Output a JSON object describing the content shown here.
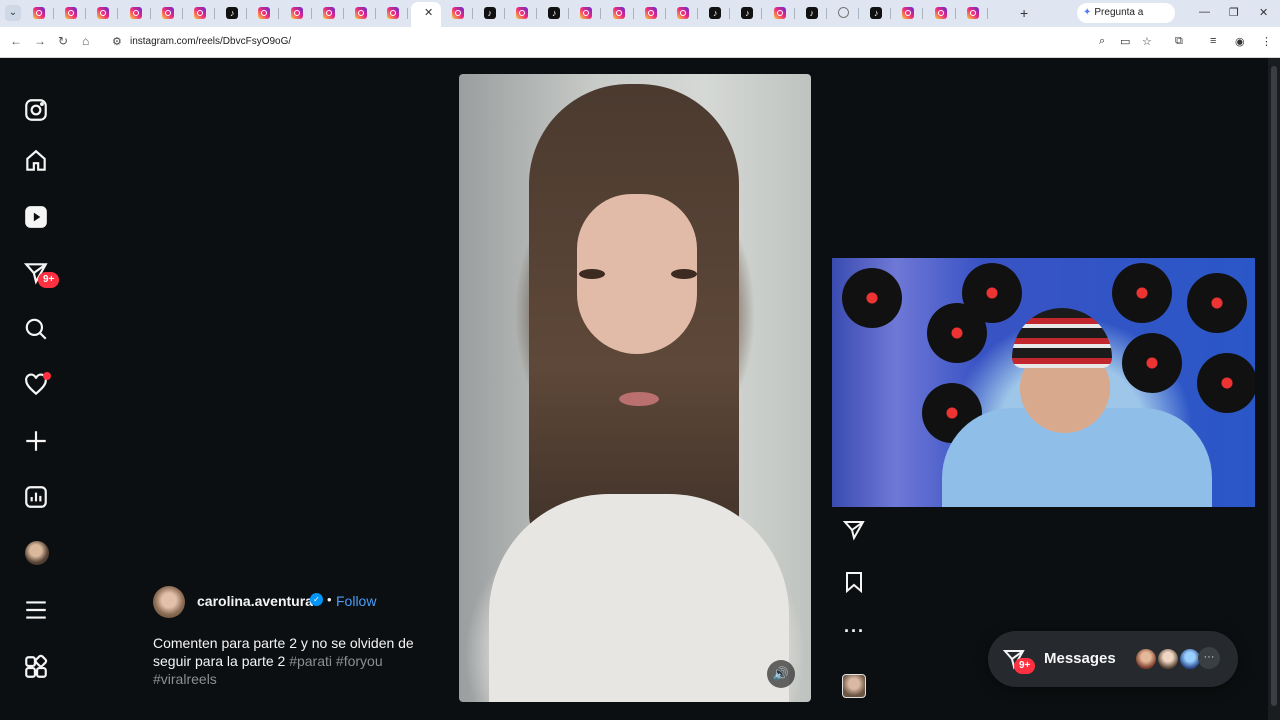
{
  "browser": {
    "url": "instagram.com/reels/DbvcFsyO9oG/",
    "gemini_label": "Pregunta a Gemini",
    "tabs": [
      "ig",
      "ig",
      "ig",
      "ig",
      "ig",
      "ig",
      "tt",
      "ig",
      "ig",
      "ig",
      "ig",
      "ig",
      "active",
      "ig",
      "tt",
      "ig",
      "tt",
      "ig",
      "ig",
      "ig",
      "ig",
      "tt",
      "tt",
      "ig",
      "tt",
      "globe",
      "tt",
      "ig",
      "ig",
      "ig"
    ]
  },
  "sidebar": {
    "items": [
      {
        "name": "instagram-logo-icon"
      },
      {
        "name": "home-icon"
      },
      {
        "name": "reels-icon"
      },
      {
        "name": "messages-icon",
        "badge": "9+"
      },
      {
        "name": "search-icon"
      },
      {
        "name": "notifications-icon"
      },
      {
        "name": "create-icon"
      },
      {
        "name": "dashboard-icon"
      },
      {
        "name": "profile-avatar"
      },
      {
        "name": "menu-icon"
      },
      {
        "name": "more-apps-icon"
      }
    ]
  },
  "reel": {
    "author": "carolina.aventura",
    "follow_label": "Follow",
    "separator": "•",
    "caption_text": "Comenten para parte 2 y no se olviden de seguir para la parte 2 ",
    "hashtags": [
      "#parati",
      "#foryou",
      "#viralreels"
    ]
  },
  "messages": {
    "label": "Messages",
    "badge": "9+",
    "more": "···"
  },
  "colors": {
    "background": "#0c0f11",
    "accent_blue": "#4a9df8",
    "badge_red": "#ff3040"
  }
}
